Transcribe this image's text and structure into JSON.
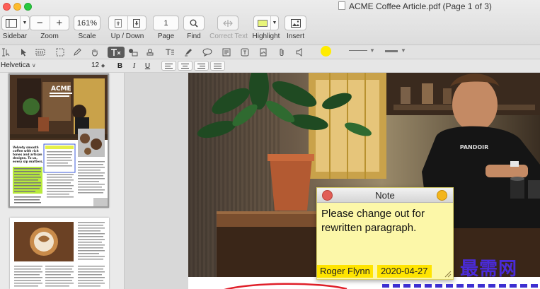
{
  "window": {
    "title": "ACME Coffee Article.pdf (Page 1 of 3)"
  },
  "toolbar": {
    "sidebar_label": "Sidebar",
    "zoom_label": "Zoom",
    "zoom_minus": "−",
    "zoom_plus": "+",
    "scale_value": "161%",
    "scale_label": "Scale",
    "updown_label": "Up / Down",
    "page_value": "1",
    "page_label": "Page",
    "find_label": "Find",
    "correct_text_label": "Correct Text",
    "highlight_label": "Highlight",
    "insert_label": "Insert"
  },
  "font_row": {
    "font_name": "Helvetica",
    "font_size": "12",
    "bold": "B",
    "italic": "I",
    "underline": "U"
  },
  "thumbnail1": {
    "brand": "ACME",
    "line1": "Velvety smooth",
    "line2": "coffee with rich",
    "line3": "tones and artisan",
    "line4": "designs. To us,",
    "line5": "every sip matters."
  },
  "note": {
    "title": "Note",
    "body": "Please change out for rewritten paragraph.",
    "author": "Roger Flynn",
    "date": "2020-04-27"
  },
  "photo": {
    "shirt_text": "PANDOIR"
  },
  "watermark": "最需网",
  "colors": {
    "highlight_swatch": "#e8f57a",
    "note_bg": "#fcf7a8",
    "note_tag": "#ffe400",
    "accent_yellow": "#ffec00",
    "watermark": "#4a2bd8"
  }
}
